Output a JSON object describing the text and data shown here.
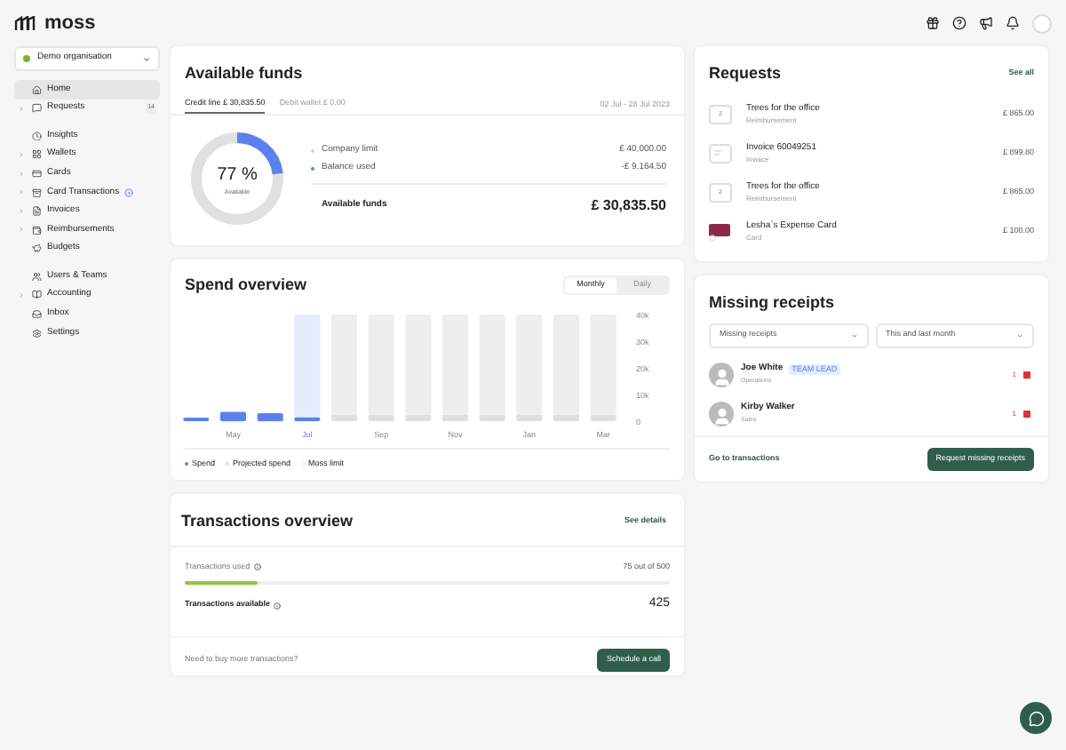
{
  "header": {
    "logo": "moss"
  },
  "sidebar": {
    "org": "Demo organisation",
    "groups": [
      [
        {
          "label": "Home",
          "selected": true,
          "expandable": false
        },
        {
          "label": "Requests",
          "selected": false,
          "expandable": true,
          "badge": "14"
        }
      ],
      [
        {
          "label": "Insights",
          "selected": false,
          "expandable": false
        },
        {
          "label": "Wallets",
          "selected": false,
          "expandable": true
        },
        {
          "label": "Cards",
          "selected": false,
          "expandable": true
        },
        {
          "label": "Card Transactions",
          "selected": false,
          "expandable": true,
          "dot": true
        },
        {
          "label": "Invoices",
          "selected": false,
          "expandable": true
        },
        {
          "label": "Reimbursements",
          "selected": false,
          "expandable": true
        },
        {
          "label": "Budgets",
          "selected": false,
          "expandable": false
        }
      ],
      [
        {
          "label": "Users & Teams",
          "selected": false,
          "expandable": false
        },
        {
          "label": "Accounting",
          "selected": false,
          "expandable": true
        },
        {
          "label": "Inbox",
          "selected": false,
          "expandable": false
        },
        {
          "label": "Settings",
          "selected": false,
          "expandable": false
        }
      ]
    ]
  },
  "funds": {
    "title": "Available funds",
    "tabs": [
      {
        "label": "Credit line",
        "amount": "£ 30,835.50",
        "selected": true
      },
      {
        "label": "Debit wallet",
        "amount": "£ 0.00",
        "selected": false
      }
    ],
    "date_range": "02 Jul - 28 Jul 2023",
    "donut": {
      "percent": "77 %",
      "caption": "Available",
      "level": 0.23
    },
    "rows": [
      {
        "label": "Company limit",
        "value": "£ 40,000.00",
        "color": "#d4d4d4"
      },
      {
        "label": "Balance used",
        "value": "-£ 9,164.50",
        "color": "#5b82ec"
      }
    ],
    "total": {
      "label": "Available funds",
      "value": "£ 30,835.50"
    }
  },
  "spend": {
    "title": "Spend overview",
    "toggle": [
      {
        "label": "Monthly",
        "selected": true
      },
      {
        "label": "Daily",
        "selected": false
      }
    ],
    "chart_data": {
      "type": "bar",
      "stacked": true,
      "categories": [
        null,
        "May",
        null,
        "Jul",
        null,
        "Sep",
        null,
        "Nov",
        null,
        "Jan",
        null,
        "Mar"
      ],
      "ylim": [
        0,
        40000
      ],
      "yticks": [
        {
          "value": 0,
          "label": "0"
        },
        {
          "value": 10000,
          "label": "10k"
        },
        {
          "value": 20000,
          "label": "20k"
        },
        {
          "value": 30000,
          "label": "30k"
        },
        {
          "value": 40000,
          "label": "40k"
        }
      ],
      "series": [
        {
          "name": "Spend",
          "color": "#5b82ec",
          "values": [
            1000,
            3500,
            3000,
            1500,
            null,
            null,
            null,
            null,
            null,
            null,
            null,
            null
          ]
        },
        {
          "name": "Projected spend",
          "color": "#e0e0e0",
          "values": [
            null,
            null,
            null,
            null,
            2500,
            2500,
            2500,
            2500,
            2500,
            2500,
            2500,
            2500
          ]
        },
        {
          "name": "Moss limit",
          "color": "#eeeeee",
          "values": [
            null,
            null,
            null,
            38500,
            37500,
            37500,
            37500,
            37500,
            37500,
            37500,
            37500,
            37500
          ]
        }
      ]
    }
  },
  "transactions": {
    "title": "Transactions overview",
    "link": "See details",
    "used_label": "Transactions used",
    "used_value": "75 out of 500",
    "level": 0.15,
    "available_label": "Transactions available",
    "available_value": "425",
    "footer_text": "Need to buy more transactions?",
    "button": "Schedule a call"
  },
  "requests": {
    "title": "Requests",
    "link": "See all",
    "items": [
      {
        "kind": "receipt",
        "icon_text": "2",
        "title": "Trees for the office",
        "subtitle": "Reimbursement",
        "amount": "£ 865.00"
      },
      {
        "kind": "invoice",
        "title": "Invoice 60049251",
        "subtitle": "Invoice",
        "amount": "£ 899.80"
      },
      {
        "kind": "receipt",
        "icon_text": "2",
        "title": "Trees for the office",
        "subtitle": "Reimbursement",
        "amount": "£ 865.00"
      },
      {
        "kind": "card",
        "title": "Lesha`s Expense Card",
        "subtitle": "Card",
        "amount": "£ 100.00"
      }
    ]
  },
  "missing": {
    "title": "Missing receipts",
    "filters": [
      "Missing receipts",
      "This and last month"
    ],
    "people": [
      {
        "name": "Joe White",
        "tag": "TEAM LEAD",
        "team": "Operations",
        "count": "1"
      },
      {
        "name": "Kirby Walker",
        "team": "Sales",
        "count": "1"
      }
    ],
    "link": "Go to transactions",
    "button": "Request missing receipts"
  }
}
